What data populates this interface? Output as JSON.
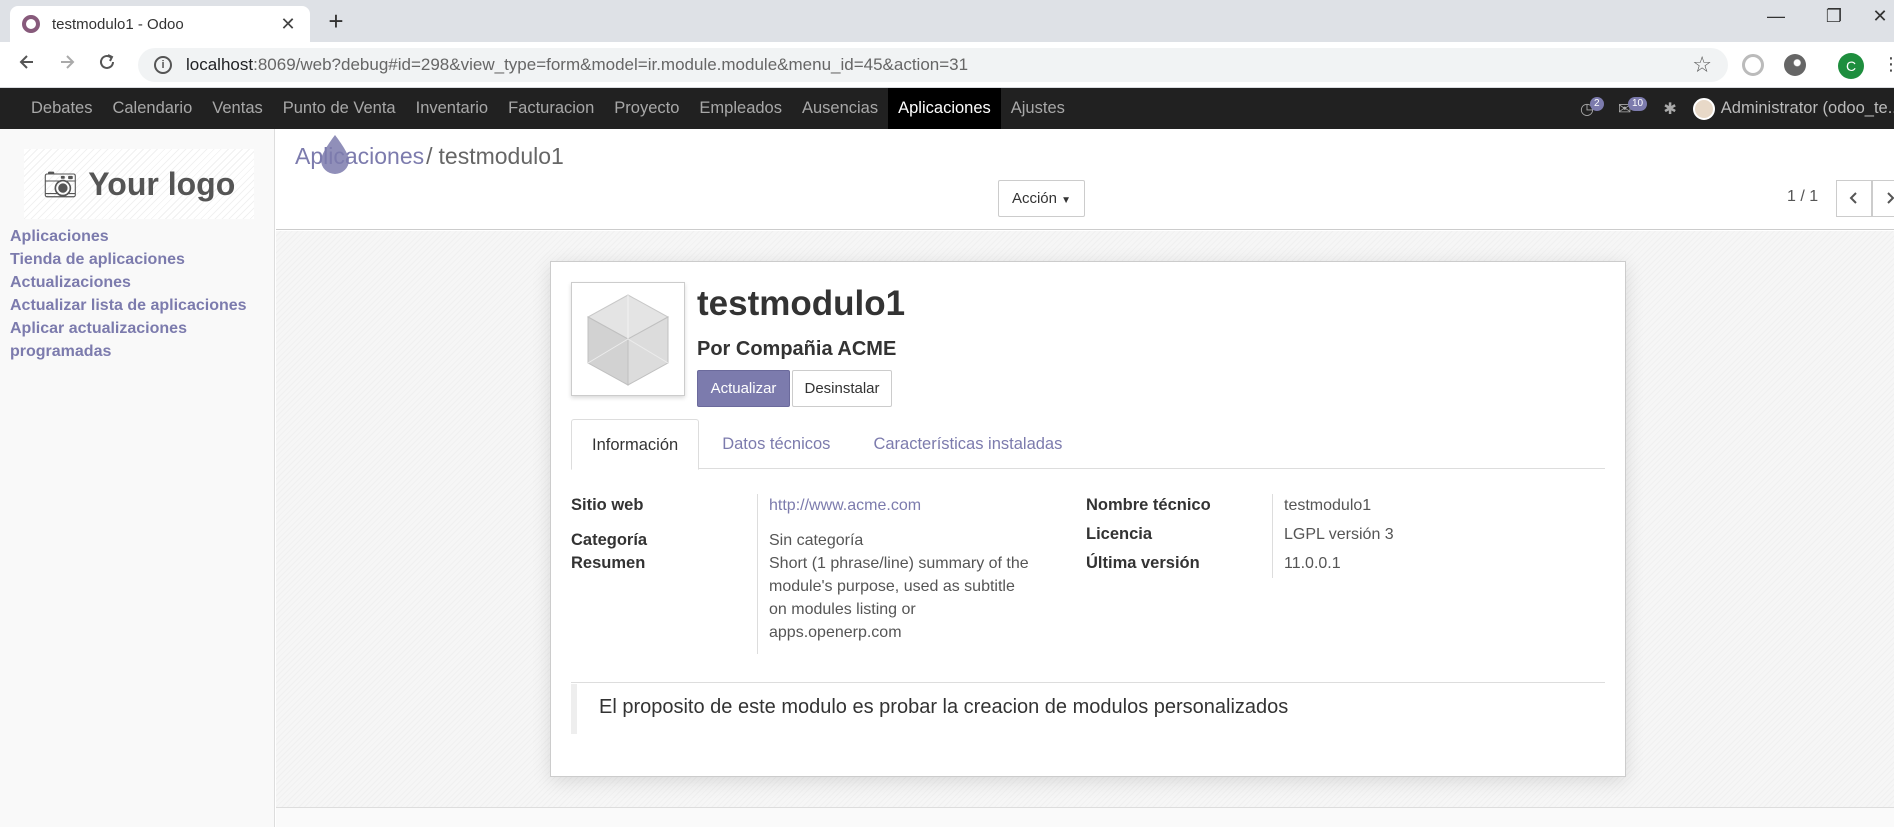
{
  "browser": {
    "tab_title": "testmodulo1 - Odoo",
    "tab_close": "✕",
    "new_tab": "+",
    "url_host": "localhost",
    "url_rest": ":8069/web?debug#id=298&view_type=form&model=ir.module.module&menu_id=45&action=31",
    "profile_initial": "C",
    "window_controls": [
      "—",
      "❐",
      "✕"
    ]
  },
  "nav": {
    "items": [
      "Debates",
      "Calendario",
      "Ventas",
      "Punto de Venta",
      "Inventario",
      "Facturacion",
      "Proyecto",
      "Empleados",
      "Ausencias",
      "Aplicaciones",
      "Ajustes"
    ],
    "active": "Aplicaciones",
    "activity_count": "2",
    "messages_count": "10",
    "user": "Administrator (odoo_te..."
  },
  "sidebar": {
    "logo_text": "Your logo",
    "links": [
      "Aplicaciones",
      "Tienda de aplicaciones",
      "Actualizaciones",
      "Actualizar lista de aplicaciones",
      "Aplicar actualizaciones",
      "programadas"
    ]
  },
  "control": {
    "breadcrumb_parent": "Aplicaciones",
    "breadcrumb_sep": "/",
    "breadcrumb_current": "testmodulo1",
    "action_label": "Acción",
    "pager": "1 / 1"
  },
  "module": {
    "name": "testmodulo1",
    "author": "Por Compañia ACME",
    "update_label": "Actualizar",
    "uninstall_label": "Desinstalar",
    "tabs": [
      "Información",
      "Datos técnicos",
      "Características instaladas"
    ],
    "active_tab": "Información",
    "left_fields": {
      "website_label": "Sitio web",
      "website": "http://www.acme.com",
      "category_label": "Categoría",
      "category": "Sin categoría",
      "summary_label": "Resumen",
      "summary_lines": [
        "Short (1 phrase/line) summary of the",
        "module's purpose, used as subtitle",
        "on modules listing or",
        "apps.openerp.com"
      ]
    },
    "right_fields": {
      "technical_name_label": "Nombre técnico",
      "technical_name": "testmodulo1",
      "license_label": "Licencia",
      "license": "LGPL versión 3",
      "version_label": "Última versión",
      "version": "11.0.0.1"
    },
    "description": "El proposito de este modulo es probar la creacion de modulos personalizados"
  },
  "colors": {
    "brand": "#7c7bad",
    "navbar": "#212121",
    "odoo_favicon": "#875a7b"
  }
}
